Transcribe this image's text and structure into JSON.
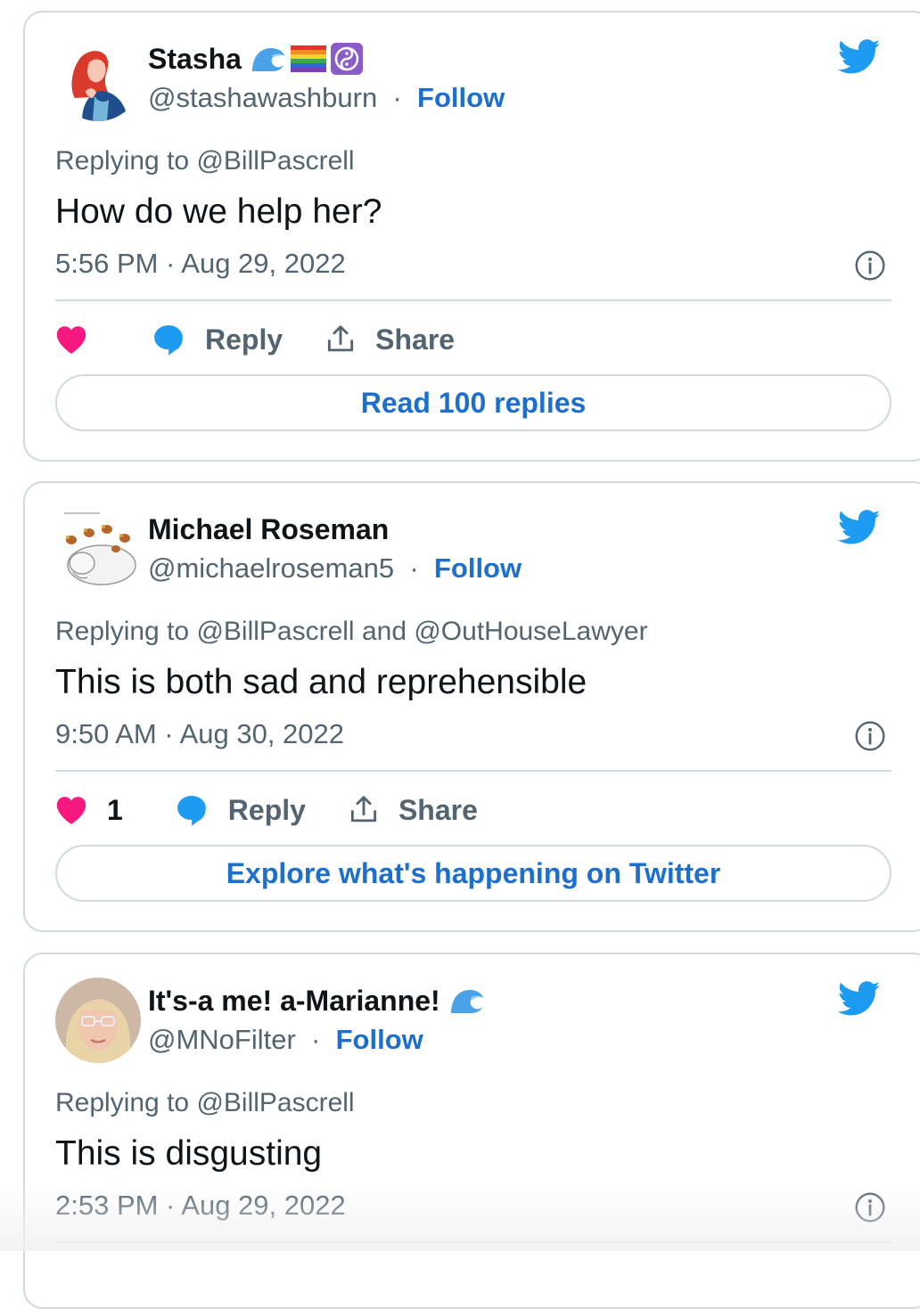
{
  "tweets": [
    {
      "name": "Stasha",
      "badges": [
        "wave-emoji",
        "rainbow-flag-emoji",
        "yin-yang-emoji"
      ],
      "handle": "@stashawashburn",
      "separator": "·",
      "follow_label": "Follow",
      "replying_prefix": "Replying to ",
      "replying_to": "@BillPascrell",
      "replying_and": "",
      "replying_to_2": "",
      "text": "How do we help her?",
      "timestamp": "5:56 PM · Aug 29, 2022",
      "like_count": "",
      "reply_label": "Reply",
      "share_label": "Share",
      "cta_label": "Read 100 replies"
    },
    {
      "name": "Michael Roseman",
      "badges": [],
      "handle": "@michaelroseman5",
      "separator": "·",
      "follow_label": "Follow",
      "replying_prefix": "Replying to ",
      "replying_to": "@BillPascrell",
      "replying_and": " and ",
      "replying_to_2": "@OutHouseLawyer",
      "text": "This is both sad and reprehensible",
      "timestamp": "9:50 AM · Aug 30, 2022",
      "like_count": "1",
      "reply_label": "Reply",
      "share_label": "Share",
      "cta_label": "Explore what's happening on Twitter"
    },
    {
      "name": "It's-a me! a-Marianne!",
      "badges": [
        "wave-emoji"
      ],
      "handle": "@MNoFilter",
      "separator": "·",
      "follow_label": "Follow",
      "replying_prefix": "Replying to ",
      "replying_to": "@BillPascrell",
      "replying_and": "",
      "replying_to_2": "",
      "text": "This is disgusting",
      "timestamp": "2:53 PM · Aug 29, 2022"
    }
  ],
  "colors": {
    "accent_blue": "#1d6fce",
    "twitter_blue": "#1d9bf0",
    "heart_pink": "#f91880",
    "muted_text": "#536471",
    "border": "#cfd9de"
  }
}
